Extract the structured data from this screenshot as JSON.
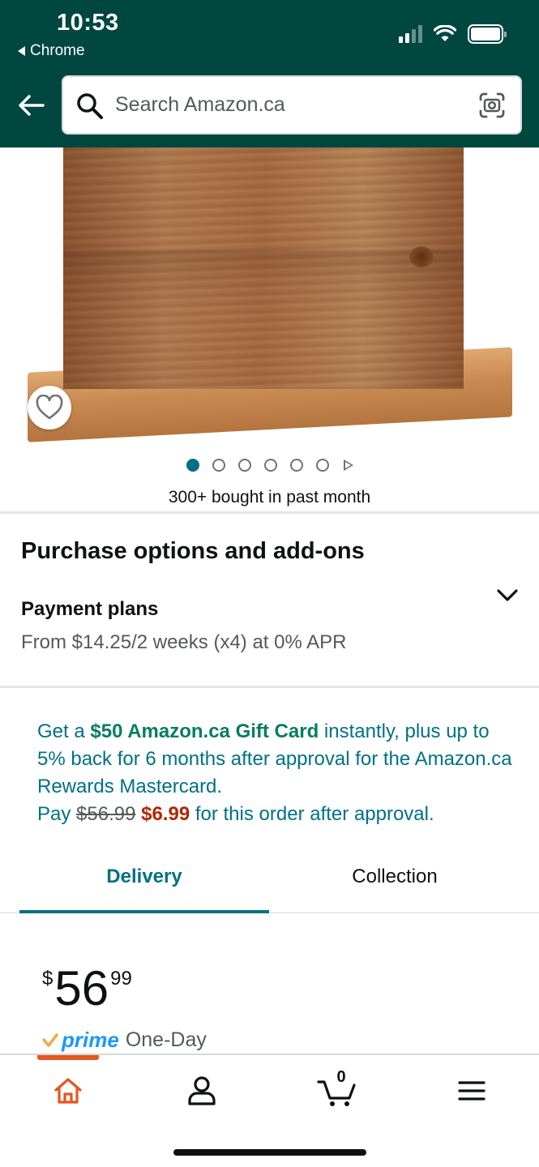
{
  "status_bar": {
    "time": "10:53",
    "back_app": "Chrome"
  },
  "search": {
    "placeholder": "Search Amazon.ca"
  },
  "product": {
    "image_dots": 6,
    "active_dot": 1,
    "bought_text": "300+ bought in past month"
  },
  "purchase_options": {
    "title": "Purchase options and add-ons",
    "payment_plans_title": "Payment plans",
    "payment_plans_sub": "From $14.25/2 weeks (x4) at 0% APR"
  },
  "promo": {
    "part1": "Get a ",
    "gift_card": "$50 Amazon.ca Gift Card",
    "part2": " instantly, plus up to 5% back for 6 months after approval for the Amazon.ca Rewards Mastercard.",
    "pay_label": "Pay ",
    "old_price": "$56.99",
    "new_price": "$6.99",
    "part3": " for this order after approval."
  },
  "tabs": {
    "delivery": "Delivery",
    "collection": "Collection"
  },
  "price": {
    "symbol": "$",
    "whole": "56",
    "fraction": "99"
  },
  "prime": {
    "logo": "prime",
    "label": "One-Day"
  },
  "bottom_nav": {
    "cart_count": "0"
  },
  "colors": {
    "header_bg": "#004740",
    "link_teal": "#007185",
    "promo_green": "#067d62",
    "price_red": "#b12704",
    "prime_blue": "#1a98ff",
    "home_accent": "#e4571e"
  }
}
